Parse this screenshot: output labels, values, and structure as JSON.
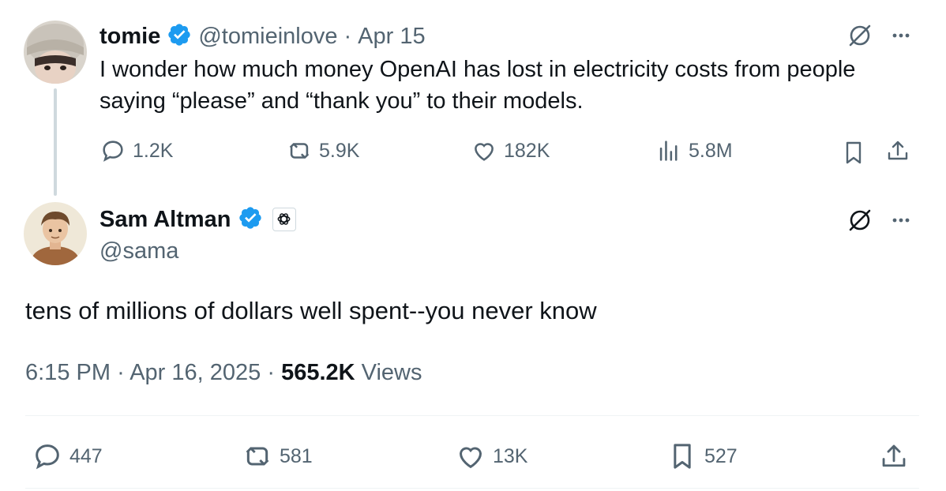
{
  "parent_tweet": {
    "display_name": "tomie",
    "handle": "@tomieinlove",
    "separator": "·",
    "date": "Apr 15",
    "text_line1": "I wonder how much money OpenAI has lost in electricity costs from people",
    "text_line2": "saying “please” and “thank you” to their models.",
    "replies": "1.2K",
    "reposts": "5.9K",
    "likes": "182K",
    "views": "5.8M"
  },
  "main_tweet": {
    "display_name": "Sam Altman",
    "handle": "@sama",
    "text": "tens of millions of dollars well spent--you never know",
    "time": "6:15 PM",
    "dot1": "·",
    "date": "Apr 16, 2025",
    "dot2": "·",
    "views_count": "565.2K",
    "views_label": " Views",
    "replies": "447",
    "reposts": "581",
    "likes": "13K",
    "bookmarks": "527"
  },
  "colors": {
    "verified": "#1d9bf0",
    "secondary_text": "#536471",
    "thread_line": "#cfd9de"
  }
}
